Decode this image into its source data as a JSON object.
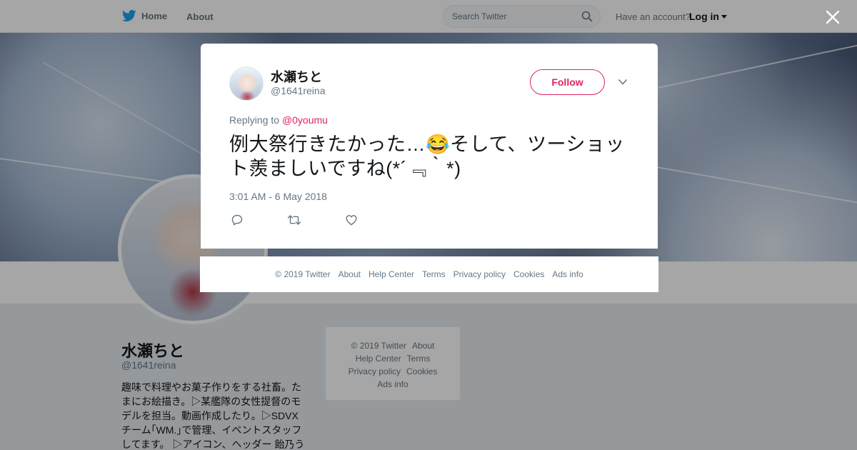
{
  "nav": {
    "home_label": "Home",
    "about_label": "About",
    "search_placeholder": "Search Twitter",
    "have_account": "Have an account?",
    "login_label": "Log in"
  },
  "profile": {
    "name": "水瀬ちと",
    "handle": "@1641reina",
    "bio_lines": [
      "趣味で料理やお菓子作りをする社畜。た",
      "まにお絵描き。▷某艦隊の女性提督のモ",
      "デルを担当。動画作成したり。▷SDVX",
      "チーム｢WM.｣で管理、イベントスタッフ",
      "してます。 ▷アイコン、ヘッダー 飴乃う"
    ]
  },
  "side_footer": {
    "copyright": "© 2019 Twitter",
    "about": "About",
    "help_center": "Help Center",
    "terms": "Terms",
    "privacy": "Privacy policy",
    "cookies": "Cookies",
    "ads_info": "Ads info"
  },
  "tweet": {
    "author_name": "水瀬ちと",
    "author_handle": "@1641reina",
    "follow_label": "Follow",
    "replying_prefix": "Replying to",
    "replying_to": "@0youmu",
    "text": "例大祭行きたかった…😂そして、ツーショット羨ましいですね(*´﹃｀*)",
    "timestamp": "3:01 AM - 6 May 2018"
  },
  "modal_footer": {
    "copyright": "© 2019 Twitter",
    "about": "About",
    "help_center": "Help Center",
    "terms": "Terms",
    "privacy": "Privacy policy",
    "cookies": "Cookies",
    "ads_info": "Ads info"
  },
  "icons": {
    "brand": "twitter-bird-icon",
    "search": "search-icon",
    "close": "close-icon",
    "more": "chevron-down-icon",
    "reply": "reply-icon",
    "retweet": "retweet-icon",
    "like": "heart-icon"
  },
  "colors": {
    "brand_blue": "#1da1f2",
    "accent_pink": "#e0245e",
    "muted_text": "#657786"
  }
}
